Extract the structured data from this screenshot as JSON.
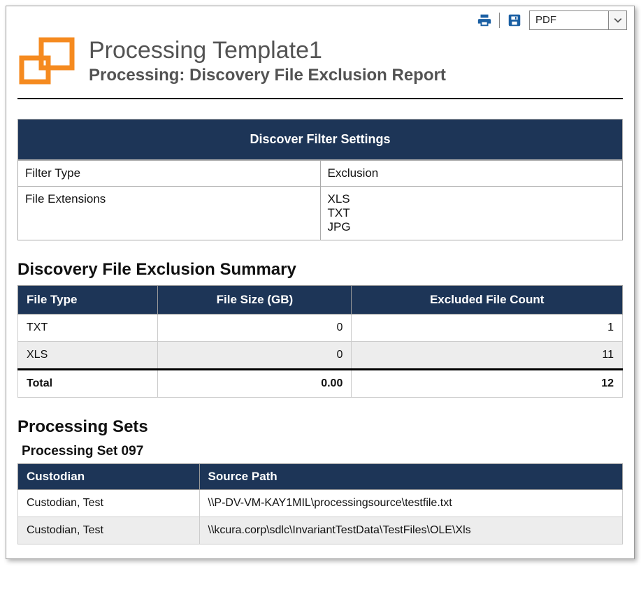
{
  "toolbar": {
    "export_format": "PDF"
  },
  "header": {
    "title": "Processing Template1",
    "subtitle": "Processing: Discovery File Exclusion Report"
  },
  "filter_settings": {
    "section_title": "Discover Filter Settings",
    "rows": [
      {
        "label": "Filter Type",
        "value": "Exclusion"
      },
      {
        "label": "File Extensions",
        "value": "XLS\nTXT\nJPG"
      }
    ]
  },
  "summary": {
    "heading": "Discovery File Exclusion Summary",
    "columns": [
      "File Type",
      "File Size (GB)",
      "Excluded File Count"
    ],
    "rows": [
      {
        "type": "TXT",
        "size": "0",
        "count": "1"
      },
      {
        "type": "XLS",
        "size": "0",
        "count": "11"
      }
    ],
    "total": {
      "label": "Total",
      "size": "0.00",
      "count": "12"
    }
  },
  "sets": {
    "heading": "Processing Sets",
    "items": [
      {
        "name": "Processing Set 097",
        "columns": [
          "Custodian",
          "Source Path"
        ],
        "rows": [
          {
            "custodian": "Custodian, Test",
            "path": "\\\\P-DV-VM-KAY1MIL\\processingsource\\testfile.txt"
          },
          {
            "custodian": "Custodian, Test",
            "path": "\\\\kcura.corp\\sdlc\\InvariantTestData\\TestFiles\\OLE\\Xls"
          }
        ]
      }
    ]
  }
}
